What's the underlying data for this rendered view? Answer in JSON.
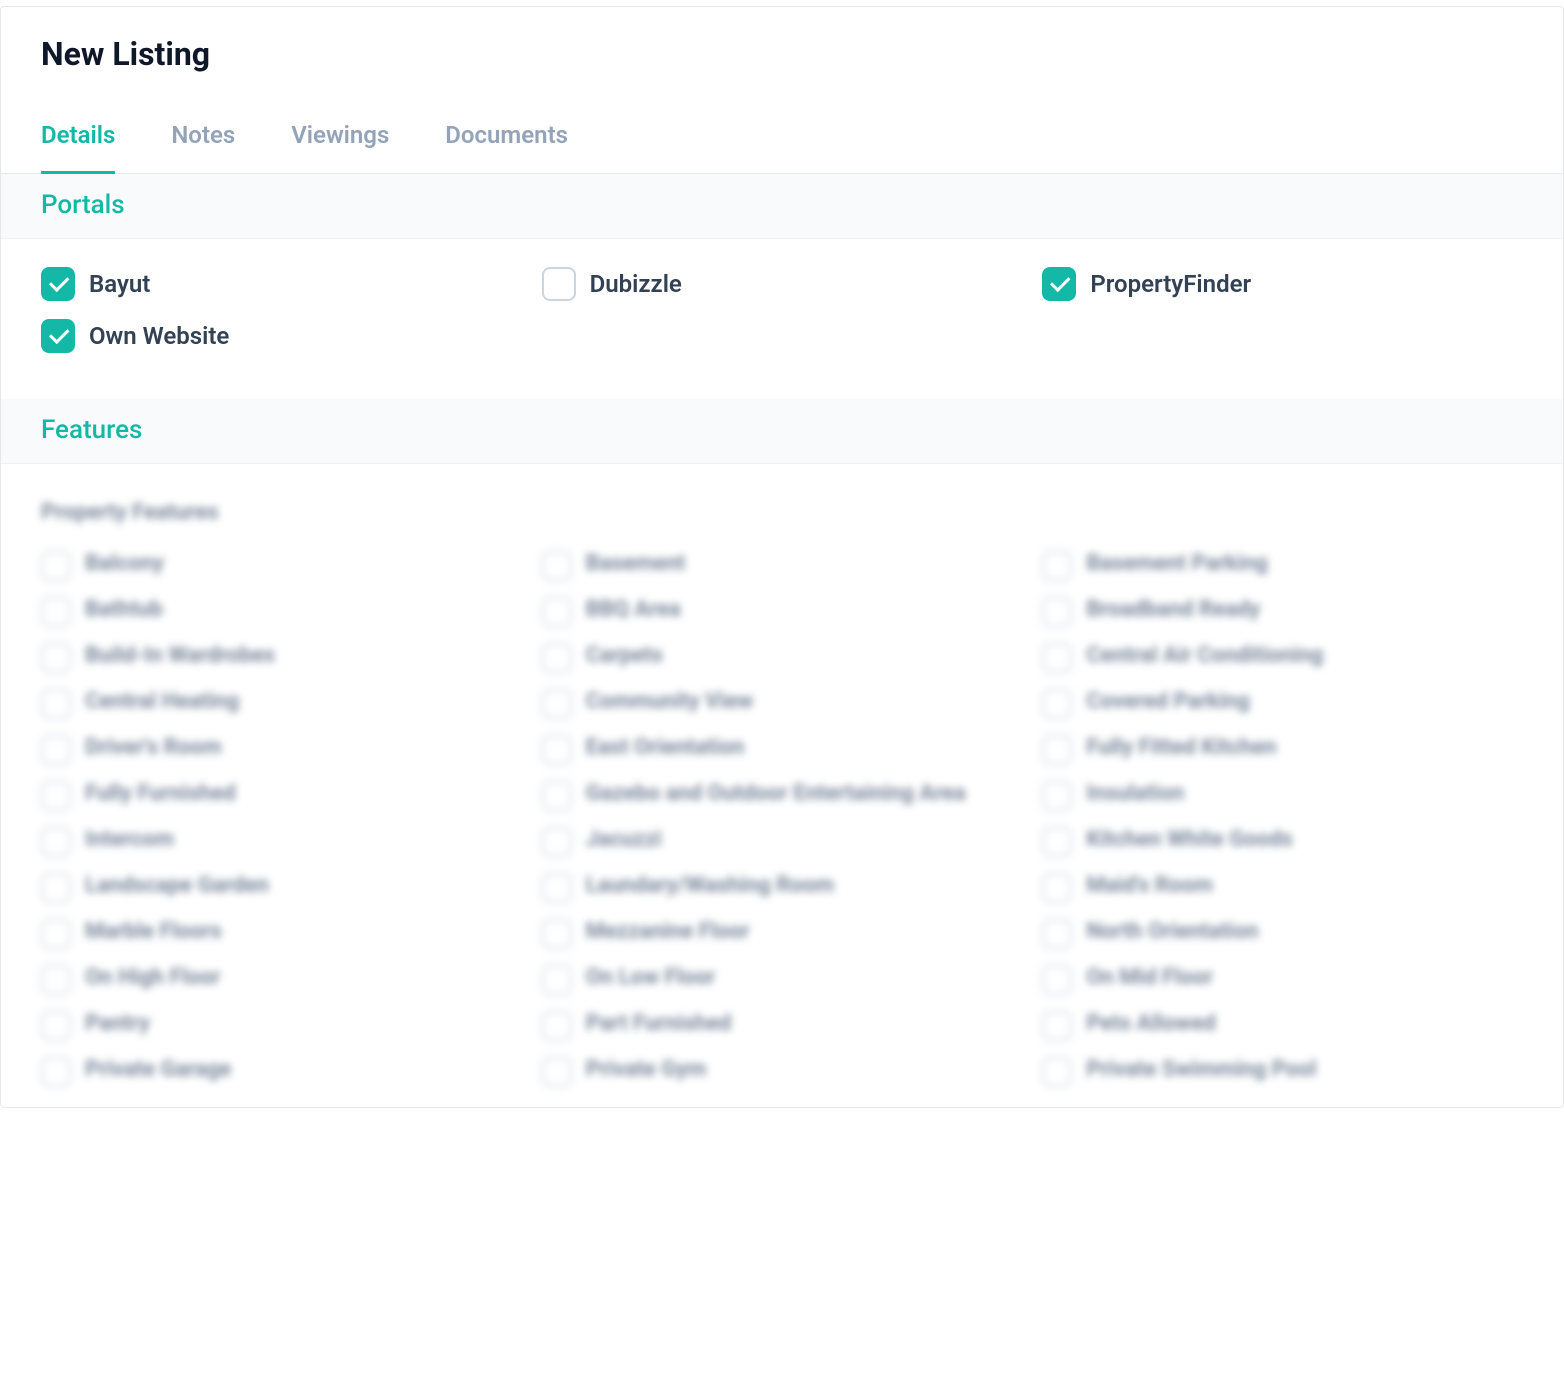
{
  "header": {
    "title": "New Listing"
  },
  "tabs": [
    {
      "label": "Details",
      "active": true
    },
    {
      "label": "Notes",
      "active": false
    },
    {
      "label": "Viewings",
      "active": false
    },
    {
      "label": "Documents",
      "active": false
    }
  ],
  "sections": {
    "portals": {
      "title": "Portals",
      "items": [
        {
          "label": "Bayut",
          "checked": true
        },
        {
          "label": "Dubizzle",
          "checked": false
        },
        {
          "label": "PropertyFinder",
          "checked": true
        },
        {
          "label": "Own Website",
          "checked": true
        }
      ]
    },
    "features": {
      "title": "Features",
      "subheading": "Property Features",
      "items": [
        {
          "label": "Balcony"
        },
        {
          "label": "Basement"
        },
        {
          "label": "Basement Parking"
        },
        {
          "label": "Bathtub"
        },
        {
          "label": "BBQ Area"
        },
        {
          "label": "Broadband Ready"
        },
        {
          "label": "Build-In Wardrobes"
        },
        {
          "label": "Carpets"
        },
        {
          "label": "Central Air Conditioning"
        },
        {
          "label": "Central Heating"
        },
        {
          "label": "Community View"
        },
        {
          "label": "Covered Parking"
        },
        {
          "label": "Driver's Room"
        },
        {
          "label": "East Orientation"
        },
        {
          "label": "Fully Fitted Kitchen"
        },
        {
          "label": "Fully Furnished"
        },
        {
          "label": "Gazebo and Outdoor Entertaining Area"
        },
        {
          "label": "Insulation"
        },
        {
          "label": "Intercom"
        },
        {
          "label": "Jacuzzi"
        },
        {
          "label": "Kitchen White Goods"
        },
        {
          "label": "Landscape Garden"
        },
        {
          "label": "Laundary/Washing Room"
        },
        {
          "label": "Maid's Room"
        },
        {
          "label": "Marble Floors"
        },
        {
          "label": "Mezzanine Floor"
        },
        {
          "label": "North Orientation"
        },
        {
          "label": "On High Floor"
        },
        {
          "label": "On Low Floor"
        },
        {
          "label": "On Mid Floor"
        },
        {
          "label": "Pantry"
        },
        {
          "label": "Part Furnished"
        },
        {
          "label": "Pets Allowed"
        },
        {
          "label": "Private Garage"
        },
        {
          "label": "Private Gym"
        },
        {
          "label": "Private Swimming Pool"
        }
      ]
    }
  }
}
